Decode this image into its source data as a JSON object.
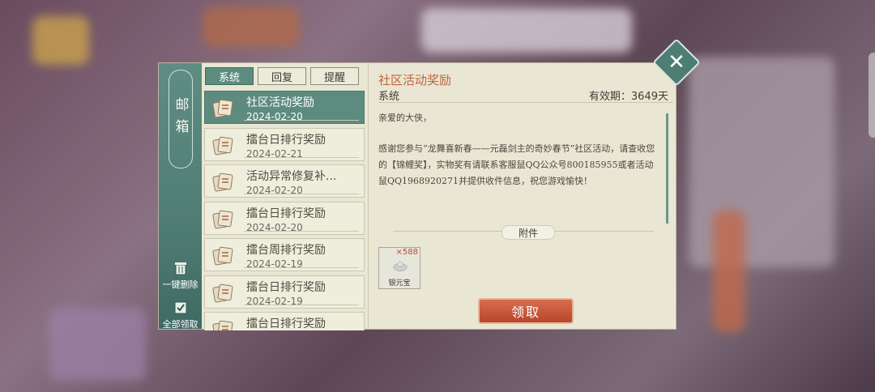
{
  "mailbox": {
    "rail_title": "邮箱",
    "delete_all_label": "一键删除",
    "claim_all_label": "全部领取",
    "tabs": [
      {
        "label": "系统",
        "active": true
      },
      {
        "label": "回复",
        "active": false
      },
      {
        "label": "提醒",
        "active": false
      }
    ],
    "items": [
      {
        "subject": "社区活动奖励",
        "date": "2024-02-20",
        "active": true
      },
      {
        "subject": "擂台日排行奖励",
        "date": "2024-02-21",
        "active": false
      },
      {
        "subject": "活动异常修复补...",
        "date": "2024-02-20",
        "active": false
      },
      {
        "subject": "擂台日排行奖励",
        "date": "2024-02-20",
        "active": false
      },
      {
        "subject": "擂台周排行奖励",
        "date": "2024-02-19",
        "active": false
      },
      {
        "subject": "擂台日排行奖励",
        "date": "2024-02-19",
        "active": false
      },
      {
        "subject": "擂台日排行奖励",
        "date": "",
        "active": false
      }
    ]
  },
  "mail": {
    "title": "社区活动奖励",
    "sender": "系统",
    "validity": "有效期：3649天",
    "greeting": "亲爱的大侠，",
    "body": "感谢您参与“龙舞喜新春——元磊剑主的奇妙春节”社区活动，请查收您的【锦鲤奖】，实物奖有请联系客服鼠QQ公众号800185955或者活动鼠QQ1968920271并提供收件信息，祝您游戏愉快！",
    "attachment_label": "附件",
    "attachment": {
      "name": "银元宝",
      "count": "×588"
    },
    "claim_label": "领取"
  },
  "colors": {
    "accent": "#5d8b80",
    "title": "#c1643a",
    "claim": "#c0513a"
  }
}
